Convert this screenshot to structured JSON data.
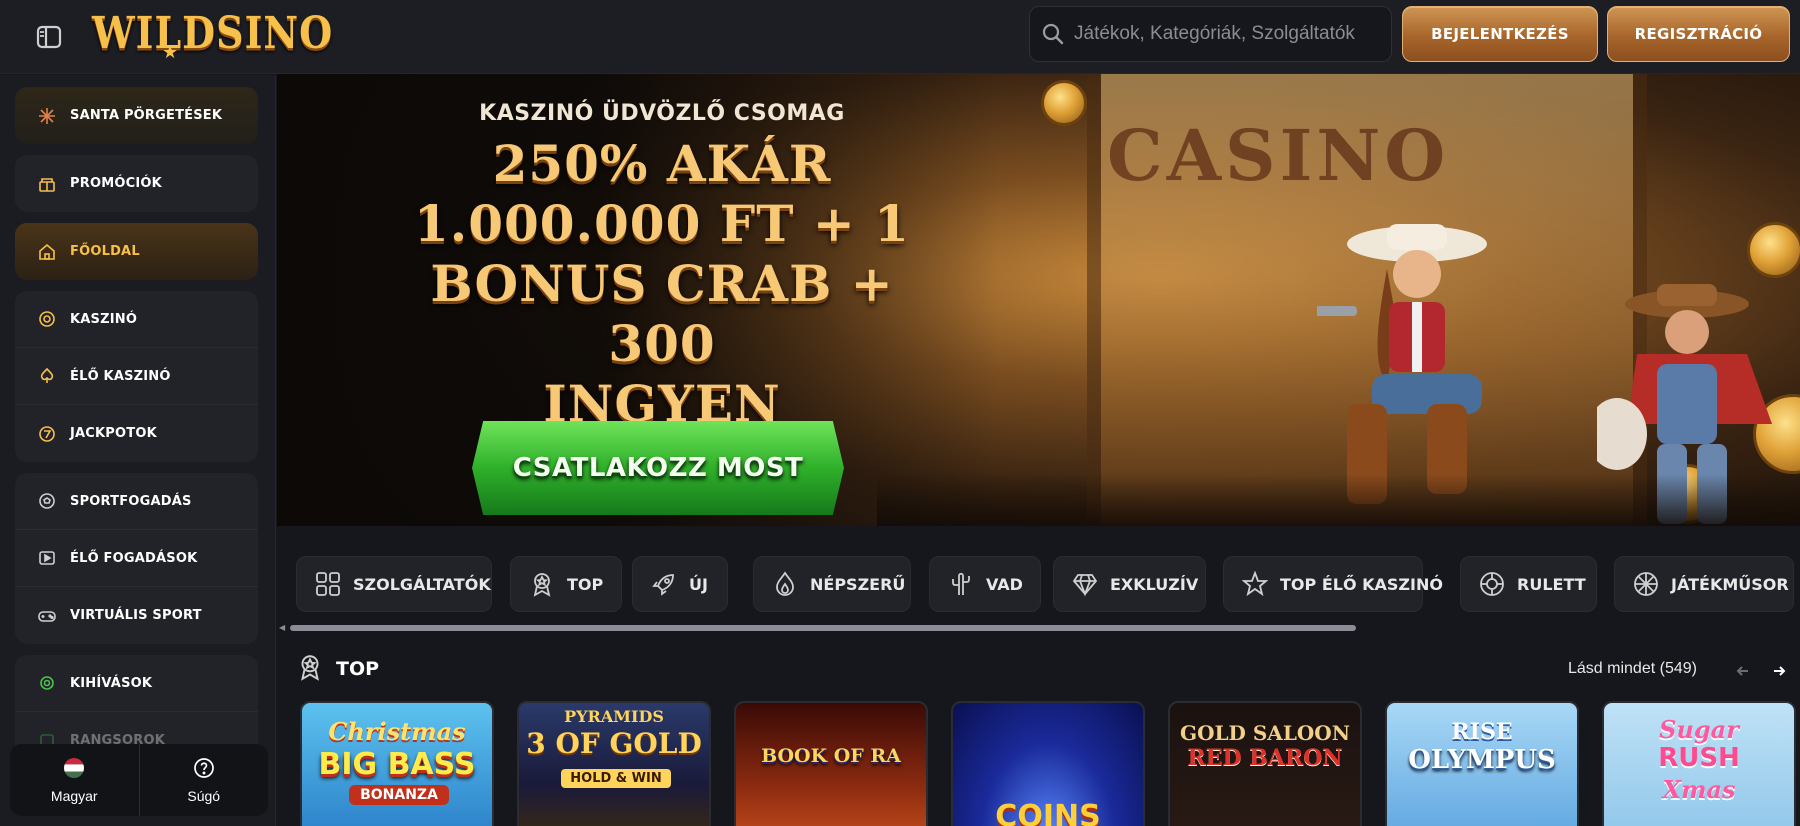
{
  "header": {
    "logo_text": "WILDSINO",
    "search_placeholder": "Játékok, Kategóriák, Szolgáltatók",
    "login_label": "BEJELENTKEZÉS",
    "register_label": "REGISZTRÁCIÓ"
  },
  "sidebar": {
    "groups": [
      [
        {
          "label": "SANTA PÖRGETÉSEK",
          "icon": "snowflake-icon"
        }
      ],
      [
        {
          "label": "PROMÓCIÓK",
          "icon": "gift-icon"
        }
      ],
      [
        {
          "label": "FŐOLDAL",
          "icon": "home-icon",
          "active": true
        }
      ],
      [
        {
          "label": "KASZINÓ",
          "icon": "casino-chip-icon"
        },
        {
          "label": "ÉLŐ KASZINÓ",
          "icon": "spade-icon"
        },
        {
          "label": "JACKPOTOK",
          "icon": "seven-icon"
        }
      ],
      [
        {
          "label": "SPORTFOGADÁS",
          "icon": "soccer-ball-icon"
        },
        {
          "label": "ÉLŐ FOGADÁSOK",
          "icon": "play-screen-icon"
        },
        {
          "label": "VIRTUÁLIS SPORT",
          "icon": "gamepad-icon"
        }
      ],
      [
        {
          "label": "KIHÍVÁSOK",
          "icon": "badge-icon"
        },
        {
          "label": "RANGSOROK",
          "icon": "trophy-icon"
        }
      ]
    ],
    "footer": {
      "language_label": "Magyar",
      "help_label": "Súgó"
    }
  },
  "banner": {
    "subtitle": "KASZINÓ ÜDVÖZLŐ CSOMAG",
    "title_lines": [
      "250% AKÁR",
      "1.000.000 FT + 1",
      "BONUS CRAB + 300",
      "INGYEN PÖRGETÉS"
    ],
    "cta_label": "CSATLAKOZZ MOST",
    "sign_text": "CASINO"
  },
  "categories": [
    {
      "label": "SZOLGÁLTATÓK",
      "icon": "grid-icon"
    },
    {
      "label": "TOP",
      "icon": "award-icon"
    },
    {
      "label": "ÚJ",
      "icon": "rocket-icon"
    },
    {
      "label": "NÉPSZERŰ",
      "icon": "flame-icon"
    },
    {
      "label": "VAD",
      "icon": "cactus-icon"
    },
    {
      "label": "EXKLUZÍV",
      "icon": "diamond-icon"
    },
    {
      "label": "TOP ÉLŐ KASZINÓ",
      "icon": "star-icon"
    },
    {
      "label": "RULETT",
      "icon": "roulette-icon"
    },
    {
      "label": "JÁTÉKMŰSOR",
      "icon": "wheel-icon"
    }
  ],
  "section": {
    "title": "TOP",
    "see_all": "Lásd mindet (549)"
  },
  "games": [
    {
      "title": "Christmas Big Bass Bonanza",
      "line1": "Christmas",
      "line2": "BIG BASS",
      "line3": "BONANZA",
      "bg": "#2a9fd8"
    },
    {
      "title": "3 Pyramids of Gold Hold & Win",
      "line1": "PYRAMIDS",
      "line2": "3 OF GOLD",
      "line3": "HOLD & WIN",
      "bg": "#1f2a4a"
    },
    {
      "title": "Book of Ra",
      "line1": "",
      "line2": "BOOK OF RA",
      "line3": "",
      "bg": "#7a1a10"
    },
    {
      "title": "Coins",
      "line1": "",
      "line2": "",
      "line3": "COINS",
      "bg": "#1a2a8a"
    },
    {
      "title": "Gold Saloon Red Baron",
      "line1": "GOLD SALOON",
      "line2": "RED BARON",
      "line3": "",
      "bg": "#1a1210"
    },
    {
      "title": "Rise of Olympus",
      "line1": "RISE",
      "line2": "OLYMPUS",
      "line3": "",
      "bg": "#6fb2e6"
    },
    {
      "title": "Sugar Rush Xmas",
      "line1": "Sugar",
      "line2": "RUSH",
      "line3": "Xmas",
      "bg": "#8fc6ea"
    }
  ]
}
